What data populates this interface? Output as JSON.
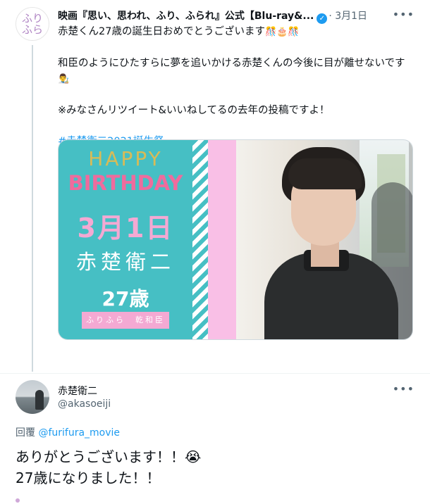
{
  "tweet1": {
    "avatar_text_line1": "ふり",
    "avatar_text_line2": "ふら",
    "display_name": "映画『思い、思われ、ふり、ふられ』公式【Blu-ray&...",
    "timestamp": "· 3月1日",
    "line1": "赤楚くん27歳の誕生日おめでとうございます",
    "line1_emojis": "🎊🎂🎊",
    "line2": "和臣のようにひたすらに夢を追いかける赤楚くんの今後に目が離せないです",
    "line2_emoji": "👨‍🎨",
    "line3": "※みなさんリツイート&いいねしてるの去年の投稿ですよ！",
    "hashtag": "#赤楚衛二2021誕生祭",
    "image": {
      "happy": "HAPPY",
      "birthday": "BIRTHDAY",
      "date": "3月1日",
      "name": "赤楚衛二",
      "age": "27歳",
      "ribbon": "ふりふら　乾和臣"
    }
  },
  "tweet2": {
    "display_name": "赤楚衛二",
    "handle": "@akasoeiji",
    "reply_label": "回覆",
    "reply_to": "@furifura_movie",
    "line1": "ありがとうございます！！",
    "line1_emoji": "😭",
    "line2": "27歳になりました！！"
  },
  "icons": {
    "more": "more-icon",
    "verified": "verified-badge-icon"
  },
  "colors": {
    "accent": "#1d9bf0",
    "secondary_text": "#536471",
    "card_teal": "#46bfc4",
    "card_pink": "#f9bfe6"
  }
}
